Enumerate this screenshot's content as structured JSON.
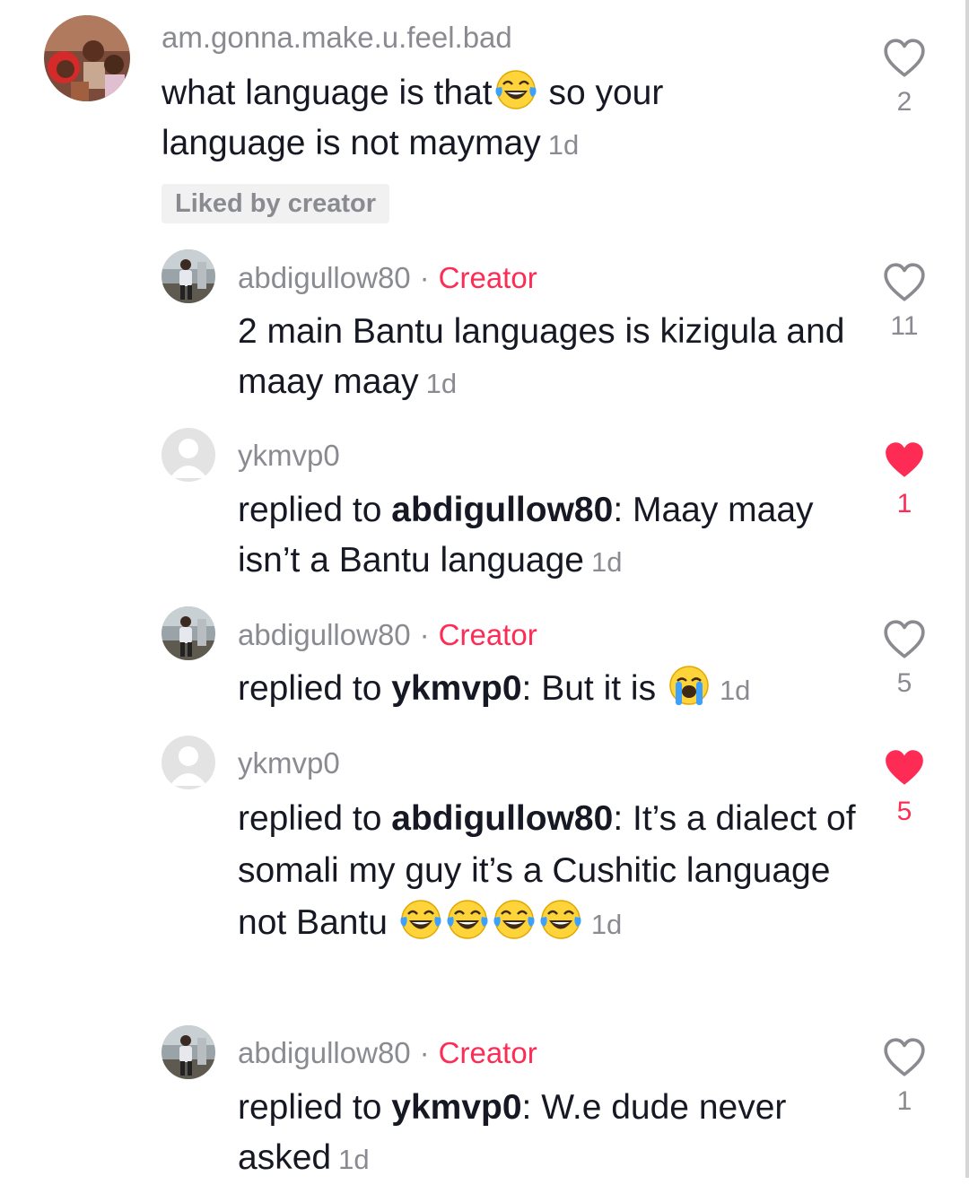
{
  "comments": [
    {
      "username": "am.gonna.make.u.feel.bad",
      "text_part1": "what language is that",
      "text_part2": " so your language is not maymay",
      "time": "1d",
      "liked_by_creator": "Liked by creator",
      "like_count": "2"
    },
    {
      "username": "abdigullow80",
      "dot": "·",
      "creator_label": "Creator",
      "text": "2 main Bantu languages is kizigula and maay maay",
      "time": "1d",
      "like_count": "11"
    },
    {
      "username": "ykmvp0",
      "replied_to": "replied to ",
      "mention": "abdigullow80",
      "text": ": Maay maay isn’t a Bantu language",
      "time": "1d",
      "like_count": "1"
    },
    {
      "username": "abdigullow80",
      "dot": "·",
      "creator_label": "Creator",
      "replied_to": "replied to ",
      "mention": "ykmvp0",
      "text": ": But it is ",
      "time": "1d",
      "like_count": "5"
    },
    {
      "username": "ykmvp0",
      "replied_to": "replied to ",
      "mention": "abdigullow80",
      "text": ": It’s a dialect of somali my guy it’s a Cushitic language not Bantu ",
      "time": "1d",
      "like_count": "5"
    },
    {
      "username": "abdigullow80",
      "dot": "·",
      "creator_label": "Creator",
      "replied_to": "replied to ",
      "mention": "ykmvp0",
      "text": ": W.e dude never asked",
      "time": "1d",
      "like_count": "1"
    }
  ],
  "colors": {
    "accent": "#fe2c55",
    "muted": "#8a8b91",
    "text": "#161823",
    "badge_bg": "#f1f1f2"
  },
  "icons": {
    "like_empty": "heart-outline-icon",
    "like_filled": "heart-filled-icon",
    "laugh": "tears-of-joy-emoji",
    "cry": "loudly-crying-emoji"
  }
}
